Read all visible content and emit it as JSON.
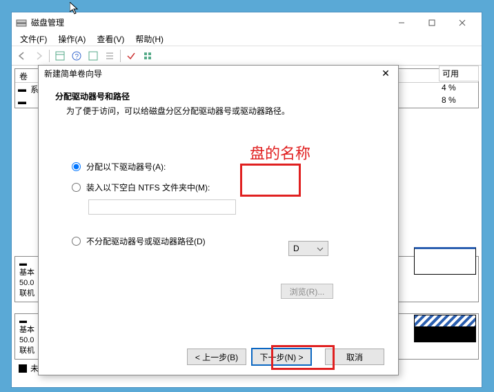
{
  "main_window": {
    "title": "磁盘管理",
    "menu": {
      "file": "文件(F)",
      "action": "操作(A)",
      "view": "查看(V)",
      "help": "帮助(H)"
    },
    "table": {
      "headers": {
        "volume": "卷",
        "available": "可用"
      },
      "rows": [
        {
          "volume": "系",
          "available": "4 %"
        },
        {
          "volume": "",
          "available": "8 %"
        }
      ]
    },
    "disks": [
      {
        "label1": "基本",
        "label2": "50.0",
        "label3": "联机"
      },
      {
        "label1": "基本",
        "label2": "50.0",
        "label3": "联机"
      }
    ],
    "legend": {
      "unallocated": "未"
    }
  },
  "wizard": {
    "title": "新建简单卷向导",
    "heading": "分配驱动器号和路径",
    "subtitle": "为了便于访问，可以给磁盘分区分配驱动器号或驱动器路径。",
    "options": {
      "assign_letter": "分配以下驱动器号(A):",
      "mount_ntfs": "装入以下空白 NTFS 文件夹中(M):",
      "no_assign": "不分配驱动器号或驱动器路径(D)"
    },
    "drive_letter": "D",
    "browse_label": "浏览(R)...",
    "buttons": {
      "back": "< 上一步(B)",
      "next": "下一步(N) >",
      "cancel": "取消"
    },
    "close_glyph": "✕"
  },
  "annotations": {
    "label": "盘的名称"
  }
}
